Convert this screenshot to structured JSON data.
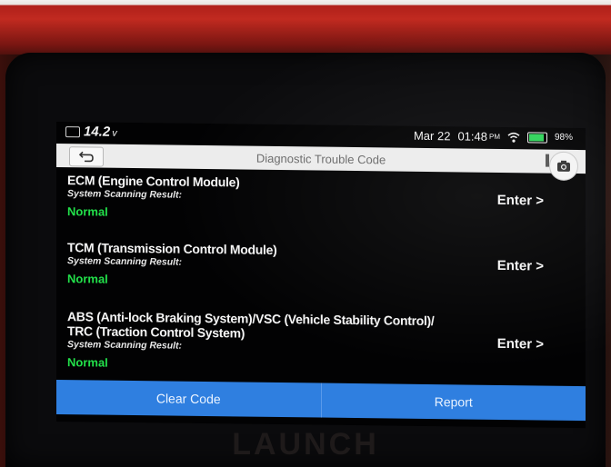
{
  "status_bar": {
    "voltage": "14.2",
    "voltage_unit": "v",
    "date": "Mar 22",
    "time": "01:48",
    "ampm": "PM",
    "battery_percent": "98%",
    "battery_level": 0.98,
    "icons": [
      "car-battery-icon",
      "wifi-icon",
      "battery-icon"
    ]
  },
  "title_bar": {
    "title": "Diagnostic Trouble Code",
    "icons": [
      "back-arrow-icon",
      "camera-icon"
    ]
  },
  "modules": [
    {
      "name_lines": [
        "ECM (Engine Control Module)"
      ],
      "scan_label": "System Scanning Result:",
      "result": "Normal",
      "enter_label": "Enter >"
    },
    {
      "name_lines": [
        "TCM (Transmission Control Module)"
      ],
      "scan_label": "System Scanning Result:",
      "result": "Normal",
      "enter_label": "Enter >"
    },
    {
      "name_lines": [
        "ABS (Anti-lock Braking System)/VSC (Vehicle Stability Control)/",
        "TRC (Traction Control System)"
      ],
      "scan_label": "System Scanning Result:",
      "result": "Normal",
      "enter_label": "Enter >"
    }
  ],
  "actions": {
    "clear_code": "Clear Code",
    "report": "Report"
  },
  "device": {
    "brand": "LAUNCH"
  },
  "colors": {
    "result_normal": "#22e04a",
    "action_bar": "#2f7fe0",
    "titlebar_bg": "#ececec",
    "screen_bg": "#020203"
  }
}
